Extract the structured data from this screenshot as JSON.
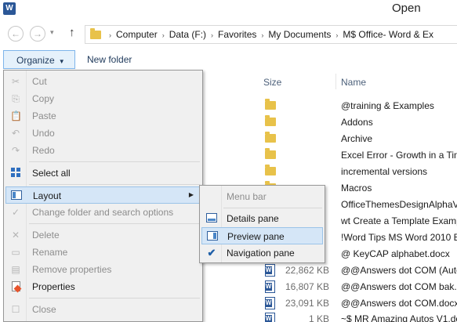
{
  "window": {
    "title": "Open",
    "app_icon_letter": "W"
  },
  "nav": {
    "back_icon": "←",
    "forward_icon": "→",
    "recent_icon": "▾",
    "up_icon": "↑",
    "breadcrumbs": [
      "Computer",
      "Data (F:)",
      "Favorites",
      "My Documents",
      "M$ Office- Word & Ex"
    ],
    "separator": "›"
  },
  "toolbar": {
    "organize_label": "Organize",
    "organize_caret": "▼",
    "new_folder_label": "New folder"
  },
  "file_list": {
    "columns": {
      "size": "Size",
      "name": "Name"
    },
    "rows": [
      {
        "type": "folder",
        "size": "",
        "name": "@training & Examples"
      },
      {
        "type": "folder",
        "size": "",
        "name": "Addons"
      },
      {
        "type": "folder",
        "size": "",
        "name": "Archive"
      },
      {
        "type": "folder",
        "size": "",
        "name": "Excel Error - Growth in a Tim"
      },
      {
        "type": "folder",
        "size": "",
        "name": "incremental versions"
      },
      {
        "type": "folder",
        "size": "",
        "name": "Macros"
      },
      {
        "type": "folder",
        "size": "",
        "name": "OfficeThemesDesignAlphaV"
      },
      {
        "type": "folder",
        "size": "",
        "name": "wt Create a Template Examp"
      },
      {
        "type": "folder",
        "size": "",
        "name": "!Word Tips MS Word 2010 Be"
      },
      {
        "type": "folder",
        "size": "",
        "name": "@ KeyCAP alphabet.docx"
      },
      {
        "type": "word",
        "size": "22,862 KB",
        "name": "@@Answers dot COM (Auto"
      },
      {
        "type": "word",
        "size": "16,807 KB",
        "name": "@@Answers dot COM bak.c"
      },
      {
        "type": "word",
        "size": "23,091 KB",
        "name": "@@Answers dot COM.docx"
      },
      {
        "type": "word",
        "size": "1 KB",
        "name": "~$ MR Amazing Autos V1.do"
      }
    ]
  },
  "organize_menu": {
    "items": [
      {
        "label": "Cut",
        "icon": "✂",
        "enabled": false
      },
      {
        "label": "Copy",
        "icon": "⎘",
        "enabled": false
      },
      {
        "label": "Paste",
        "icon": "📋",
        "enabled": false
      },
      {
        "label": "Undo",
        "icon": "↶",
        "enabled": false
      },
      {
        "label": "Redo",
        "icon": "↷",
        "enabled": false
      },
      {
        "label": "Select all",
        "enabled": true
      },
      {
        "label": "Layout",
        "enabled": true,
        "submenu_arrow": "▶"
      },
      {
        "label": "Change folder and search options",
        "icon": "✓",
        "enabled": false
      },
      {
        "label": "Delete",
        "icon": "✕",
        "enabled": false
      },
      {
        "label": "Rename",
        "icon": "▭",
        "enabled": false
      },
      {
        "label": "Remove properties",
        "icon": "▤",
        "enabled": false
      },
      {
        "label": "Properties",
        "enabled": true
      },
      {
        "label": "Close",
        "icon": "☐",
        "enabled": false
      }
    ]
  },
  "layout_submenu": {
    "items": [
      {
        "label": "Menu bar",
        "enabled": false,
        "checked": false
      },
      {
        "label": "Details pane",
        "enabled": true,
        "checked": false
      },
      {
        "label": "Preview pane",
        "enabled": true,
        "checked": false,
        "highlighted": true
      },
      {
        "label": "Navigation pane",
        "enabled": true,
        "checked": true,
        "check_glyph": "✔"
      }
    ]
  },
  "colors": {
    "accent": "#2b5797",
    "menu_highlight": "#d5e6f7",
    "menu_bg": "#f0f0f0",
    "folder": "#e8c24a"
  }
}
